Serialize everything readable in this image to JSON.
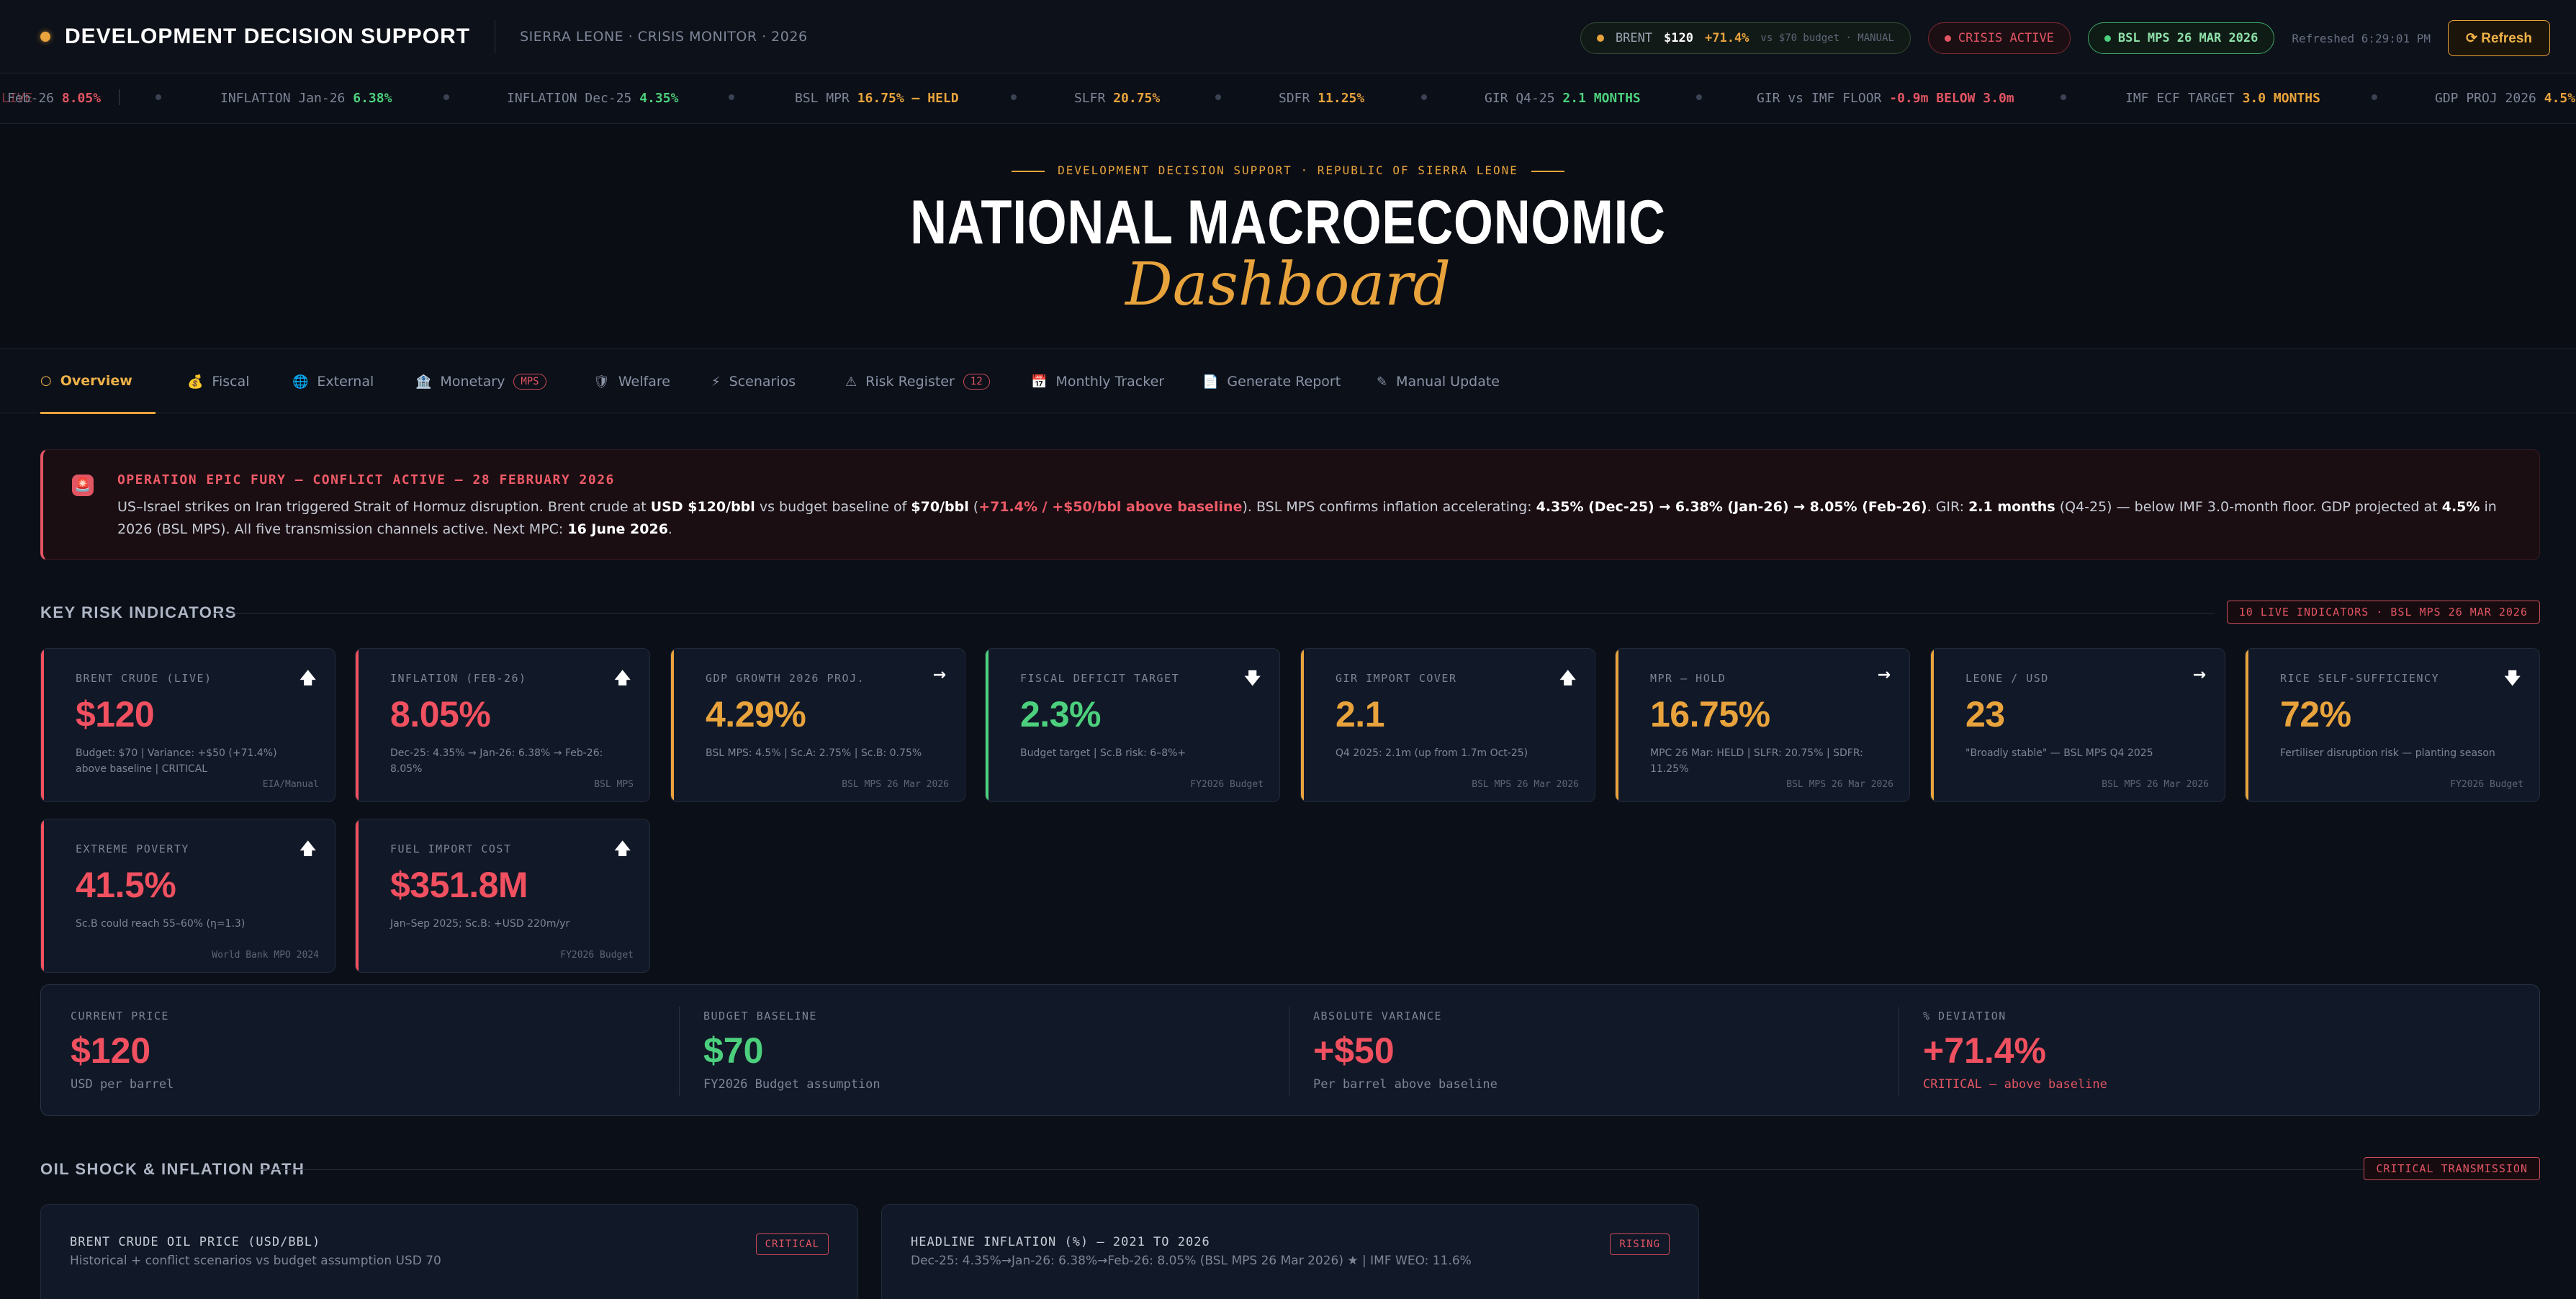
{
  "topbar": {
    "brand": "DEVELOPMENT DECISION SUPPORT",
    "subtitle": "SIERRA LEONE · CRISIS MONITOR · 2026",
    "brent_label": "BRENT",
    "brent_price": "$120",
    "brent_change": "+71.4%",
    "brent_vs": "vs $70 budget · MANUAL",
    "crisis_label": "CRISIS ACTIVE",
    "bsl_label": "BSL MPS 26 MAR 2026",
    "refreshed": "Refreshed 6:29:01 PM",
    "refresh_button": "⟳ Refresh"
  },
  "ticker": [
    {
      "label": "Feb-26",
      "value": "8.05%",
      "color": "#e25563"
    },
    {
      "label": "INFLATION Jan-26",
      "value": "6.38%",
      "color": "#4cd07d"
    },
    {
      "label": "INFLATION Dec-25",
      "value": "4.35%",
      "color": "#4cd07d"
    },
    {
      "label": "BSL MPR",
      "value": "16.75% — HELD",
      "color": "#e8a33c"
    },
    {
      "label": "SLFR",
      "value": "20.75%",
      "color": "#e8a33c"
    },
    {
      "label": "SDFR",
      "value": "11.25%",
      "color": "#e8a33c"
    },
    {
      "label": "GIR Q4-25",
      "value": "2.1 MONTHS",
      "color": "#4cd07d"
    },
    {
      "label": "GIR vs IMF FLOOR",
      "value": "-0.9m BELOW 3.0m",
      "color": "#e25563"
    },
    {
      "label": "IMF ECF TARGET",
      "value": "3.0 MONTHS",
      "color": "#e8a33c"
    },
    {
      "label": "GDP PROJ 2026",
      "value": "4.5%",
      "color": "#e8a33c"
    }
  ],
  "ticker_ghost": "LIVE",
  "hero": {
    "eyebrow": "DEVELOPMENT DECISION SUPPORT · REPUBLIC OF SIERRA LEONE",
    "title": "NATIONAL MACROECONOMIC",
    "subtitle": "Dashboard"
  },
  "tabs": [
    {
      "icon": "○",
      "label": "Overview",
      "active": true
    },
    {
      "icon": "💰",
      "label": "Fiscal"
    },
    {
      "icon": "🌐",
      "label": "External"
    },
    {
      "icon": "🏦",
      "label": "Monetary",
      "badge": "MPS"
    },
    {
      "icon": "🛡",
      "label": "Welfare"
    },
    {
      "icon": "⚡",
      "label": "Scenarios"
    },
    {
      "icon": "⚠",
      "label": "Risk Register",
      "badge": "12"
    },
    {
      "icon": "📅",
      "label": "Monthly Tracker"
    },
    {
      "icon": "📄",
      "label": "Generate Report"
    },
    {
      "icon": "✎",
      "label": "Manual Update"
    }
  ],
  "alert": {
    "icon": "🚨",
    "title": "OPERATION EPIC FURY — CONFLICT ACTIVE — 28 FEBRUARY 2026",
    "p1": "US–Israel strikes on Iran triggered Strait of Hormuz disruption. Brent crude at ",
    "b1": "USD $120/bbl",
    "p2": " vs budget baseline of ",
    "b2": "$70/bbl",
    "p3": " (",
    "h1": "+71.4% / +$50/bbl above baseline",
    "p4": "). BSL MPS confirms inflation accelerating: ",
    "b3": "4.35% (Dec-25) → 6.38% (Jan-26) → 8.05% (Feb-26)",
    "p5": ". GIR: ",
    "b4": "2.1 months",
    "p6": " (Q4-25) — below IMF 3.0-month floor. GDP projected at ",
    "b5": "4.5%",
    "p7": " in 2026 (BSL MPS). All five transmission channels active. Next MPC: ",
    "b6": "16 June 2026",
    "p8": "."
  },
  "kri": {
    "title": "KEY RISK INDICATORS",
    "badge": "10 LIVE INDICATORS · BSL MPS 26 MAR 2026",
    "cards": [
      {
        "label": "BRENT CRUDE (LIVE)",
        "arrow": "🡅",
        "value": "$120",
        "color": "#f0505f",
        "note": "Budget: $70 | Variance: +$50 (+71.4%) above baseline | CRITICAL",
        "source": "EIA/Manual"
      },
      {
        "label": "INFLATION (FEB-26)",
        "arrow": "🡅",
        "value": "8.05%",
        "color": "#f0505f",
        "note": "Dec-25: 4.35% → Jan-26: 6.38% → Feb-26: 8.05%",
        "source": "BSL MPS"
      },
      {
        "label": "GDP GROWTH 2026 PROJ.",
        "arrow": "→",
        "value": "4.29%",
        "color": "#e8a33c",
        "note": "BSL MPS: 4.5% | Sc.A: 2.75% | Sc.B: 0.75%",
        "source": "BSL MPS 26 Mar 2026"
      },
      {
        "label": "FISCAL DEFICIT TARGET",
        "arrow": "🡇",
        "value": "2.3%",
        "color": "#4cd07d",
        "note": "Budget target | Sc.B risk: 6–8%+",
        "source": "FY2026 Budget"
      },
      {
        "label": "GIR IMPORT COVER",
        "arrow": "🡅",
        "value": "2.1",
        "color": "#e8a33c",
        "note": "Q4 2025: 2.1m (up from 1.7m Oct-25)",
        "source": "BSL MPS 26 Mar 2026"
      },
      {
        "label": "MPR — HOLD",
        "arrow": "→",
        "value": "16.75%",
        "color": "#e8a33c",
        "note": "MPC 26 Mar: HELD | SLFR: 20.75% | SDFR: 11.25%",
        "source": "BSL MPS 26 Mar 2026"
      },
      {
        "label": "LEONE / USD",
        "arrow": "→",
        "value": "23",
        "color": "#e8a33c",
        "note": "\"Broadly stable\" — BSL MPS Q4 2025",
        "source": "BSL MPS 26 Mar 2026"
      },
      {
        "label": "RICE SELF-SUFFICIENCY",
        "arrow": "🡇",
        "value": "72%",
        "color": "#e8a33c",
        "note": "Fertiliser disruption risk — planting season",
        "source": "FY2026 Budget"
      },
      {
        "label": "EXTREME POVERTY",
        "arrow": "🡅",
        "value": "41.5%",
        "color": "#f0505f",
        "note": "Sc.B could reach 55–60% (η=1.3)",
        "source": "World Bank MPO 2024"
      },
      {
        "label": "FUEL IMPORT COST",
        "arrow": "🡅",
        "value": "$351.8M",
        "color": "#f0505f",
        "note": "Jan–Sep 2025; Sc.B: +USD 220m/yr",
        "source": "FY2026 Budget"
      }
    ]
  },
  "price_strip": [
    {
      "label": "CURRENT PRICE",
      "value": "$120",
      "sub": "USD per barrel",
      "color": "#f0505f",
      "sub_color": "#7d8597"
    },
    {
      "label": "BUDGET BASELINE",
      "value": "$70",
      "sub": "FY2026 Budget assumption",
      "color": "#4cd07d",
      "sub_color": "#7d8597"
    },
    {
      "label": "ABSOLUTE VARIANCE",
      "value": "+$50",
      "sub": "Per barrel above baseline",
      "color": "#f0505f",
      "sub_color": "#7d8597"
    },
    {
      "label": "% DEVIATION",
      "value": "+71.4%",
      "sub": "CRITICAL — above baseline",
      "color": "#f0505f",
      "sub_color": "#e25563"
    }
  ],
  "oil_section": {
    "title": "OIL SHOCK & INFLATION PATH",
    "badge": "CRITICAL TRANSMISSION"
  },
  "panels": [
    {
      "title": "BRENT CRUDE OIL PRICE (USD/BBL)",
      "sub": "Historical + conflict scenarios vs budget assumption USD 70",
      "badge": "CRITICAL"
    },
    {
      "title": "HEADLINE INFLATION (%) — 2021 TO 2026",
      "sub": "Dec-25: 4.35%→Jan-26: 6.38%→Feb-26: 8.05% (BSL MPS 26 Mar 2026) ★ | IMF WEO: 11.6%",
      "badge": "RISING"
    }
  ]
}
